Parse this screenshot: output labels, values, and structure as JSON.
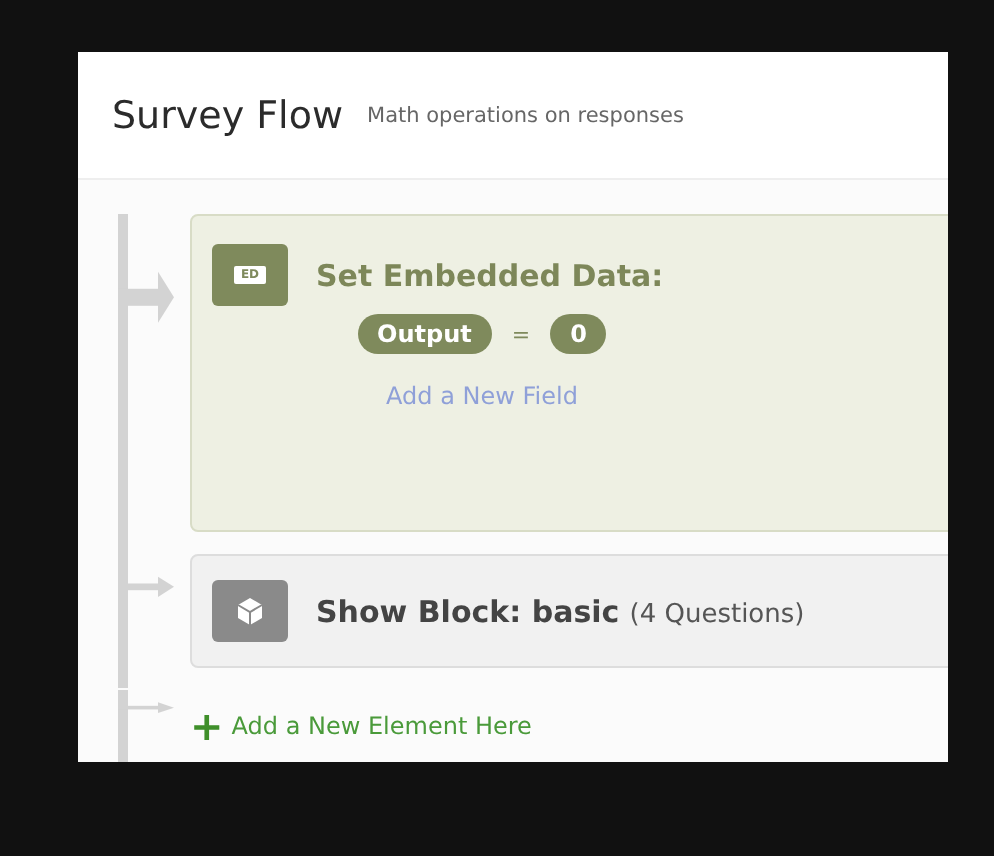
{
  "header": {
    "title": "Survey Flow",
    "subtitle": "Math operations on responses"
  },
  "elements": [
    {
      "kind": "embedded_data",
      "icon_label": "ED",
      "title": "Set Embedded Data:",
      "fields": [
        {
          "name": "Output",
          "operator": "=",
          "value": "0"
        }
      ],
      "add_field": "Add a New Field"
    },
    {
      "kind": "block",
      "title": "Show Block: basic",
      "count": "(4 Questions)"
    }
  ],
  "add_element": {
    "icon": "+",
    "label": "Add a New Element Here"
  }
}
